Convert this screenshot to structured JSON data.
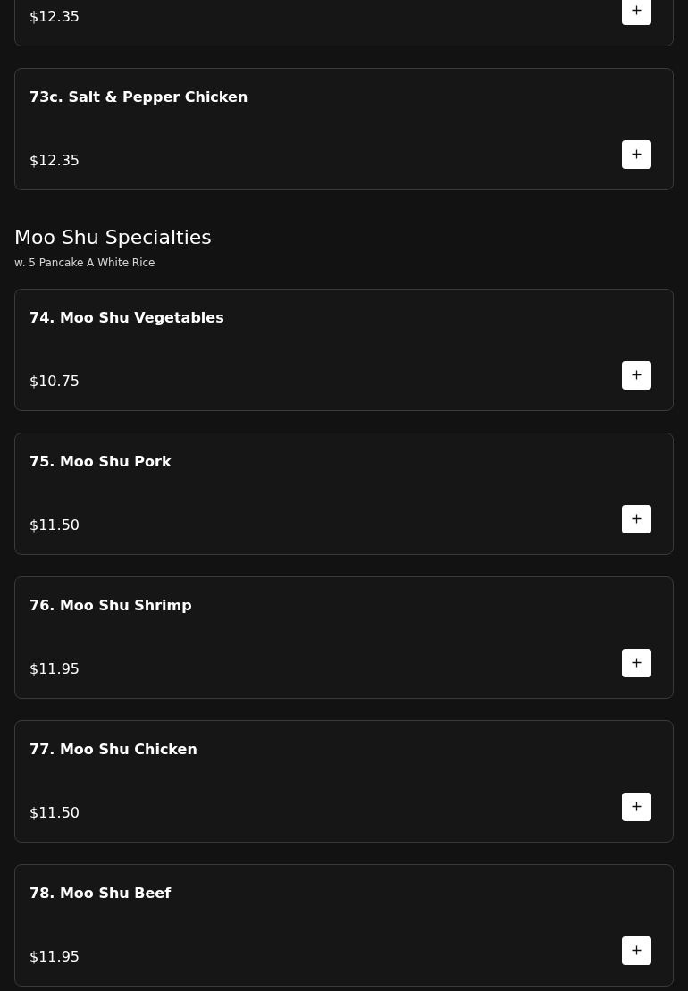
{
  "sections": [
    {
      "items": [
        {
          "price": "$12.35"
        },
        {
          "name": "73c. Salt & Pepper Chicken",
          "price": "$12.35"
        }
      ]
    },
    {
      "title": "Moo Shu Specialties",
      "subtitle": "w. 5 Pancake A White Rice",
      "items": [
        {
          "name": "74. Moo Shu Vegetables",
          "price": "$10.75"
        },
        {
          "name": "75. Moo Shu Pork",
          "price": "$11.50"
        },
        {
          "name": "76. Moo Shu Shrimp",
          "price": "$11.95"
        },
        {
          "name": "77. Moo Shu Chicken",
          "price": "$11.50"
        },
        {
          "name": "78. Moo Shu Beef",
          "price": "$11.95"
        }
      ]
    }
  ]
}
